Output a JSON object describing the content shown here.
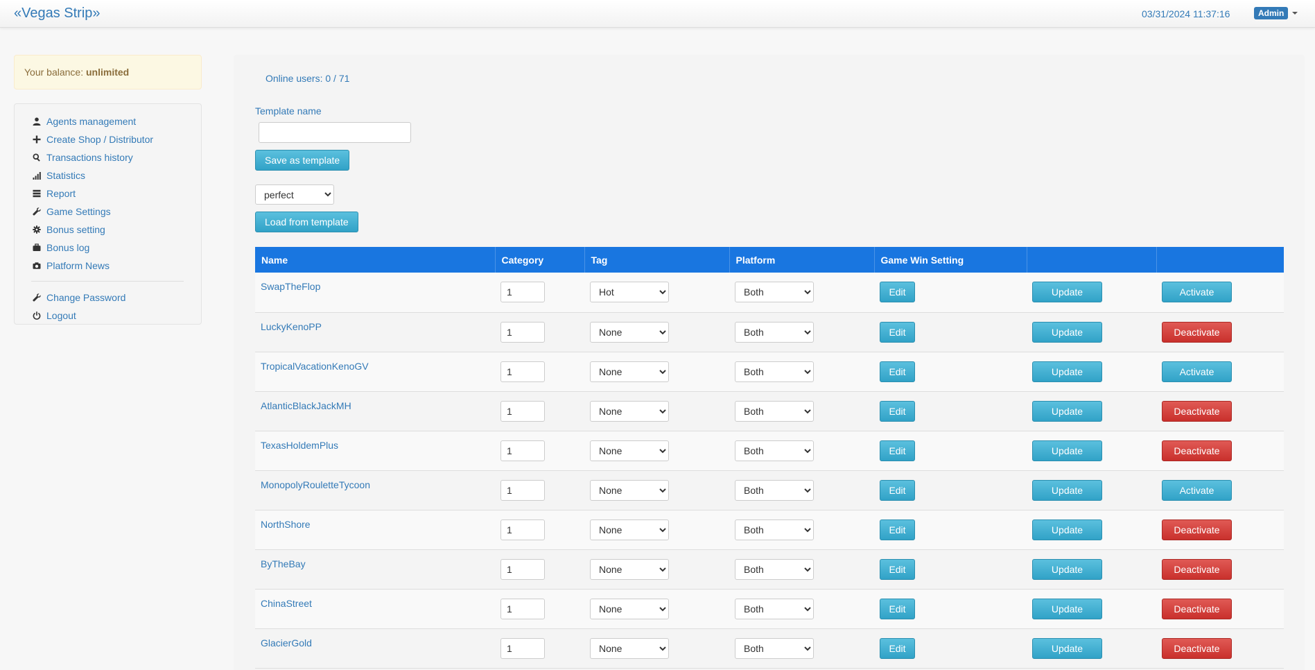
{
  "navbar": {
    "brand": "«Vegas Strip»",
    "datetime": "03/31/2024 11:37:16",
    "user": "Admin"
  },
  "balance": {
    "label": "Your balance:",
    "value": "unlimited"
  },
  "sidebar": {
    "items": [
      {
        "label": "Agents management",
        "icon": "user-icon"
      },
      {
        "label": "Create Shop / Distributor",
        "icon": "plus-icon"
      },
      {
        "label": "Transactions history",
        "icon": "search-icon"
      },
      {
        "label": "Statistics",
        "icon": "signal-icon"
      },
      {
        "label": "Report",
        "icon": "list-icon"
      },
      {
        "label": "Game Settings",
        "icon": "wrench-icon"
      },
      {
        "label": "Bonus setting",
        "icon": "gear-icon"
      },
      {
        "label": "Bonus log",
        "icon": "briefcase-icon"
      },
      {
        "label": "Platform News",
        "icon": "camera-icon"
      }
    ],
    "account": [
      {
        "label": "Change Password",
        "icon": "wrench-icon"
      },
      {
        "label": "Logout",
        "icon": "power-icon"
      }
    ]
  },
  "main": {
    "online_users": "Online users: 0 / 71",
    "template_name_label": "Template name",
    "template_name_value": "",
    "save_template_label": "Save as template",
    "template_select_value": "perfect",
    "load_template_label": "Load from template"
  },
  "table": {
    "headers": [
      "Name",
      "Category",
      "Tag",
      "Platform",
      "Game Win Setting",
      "",
      ""
    ],
    "edit_label": "Edit",
    "update_label": "Update",
    "rows": [
      {
        "name": "SwapTheFlop",
        "category": "1",
        "tag": "Hot",
        "platform": "Both",
        "action": "Activate"
      },
      {
        "name": "LuckyKenoPP",
        "category": "1",
        "tag": "None",
        "platform": "Both",
        "action": "Deactivate"
      },
      {
        "name": "TropicalVacationKenoGV",
        "category": "1",
        "tag": "None",
        "platform": "Both",
        "action": "Activate"
      },
      {
        "name": "AtlanticBlackJackMH",
        "category": "1",
        "tag": "None",
        "platform": "Both",
        "action": "Deactivate"
      },
      {
        "name": "TexasHoldemPlus",
        "category": "1",
        "tag": "None",
        "platform": "Both",
        "action": "Deactivate"
      },
      {
        "name": "MonopolyRouletteTycoon",
        "category": "1",
        "tag": "None",
        "platform": "Both",
        "action": "Activate"
      },
      {
        "name": "NorthShore",
        "category": "1",
        "tag": "None",
        "platform": "Both",
        "action": "Deactivate"
      },
      {
        "name": "ByTheBay",
        "category": "1",
        "tag": "None",
        "platform": "Both",
        "action": "Deactivate"
      },
      {
        "name": "ChinaStreet",
        "category": "1",
        "tag": "None",
        "platform": "Both",
        "action": "Deactivate"
      },
      {
        "name": "GlacierGold",
        "category": "1",
        "tag": "None",
        "platform": "Both",
        "action": "Deactivate"
      }
    ]
  },
  "colors": {
    "primary": "#337ab7",
    "table_header": "#1976e0",
    "info_button": "#31a2c7",
    "danger_button": "#c9302c",
    "balance_bg": "#fcf8e3"
  }
}
